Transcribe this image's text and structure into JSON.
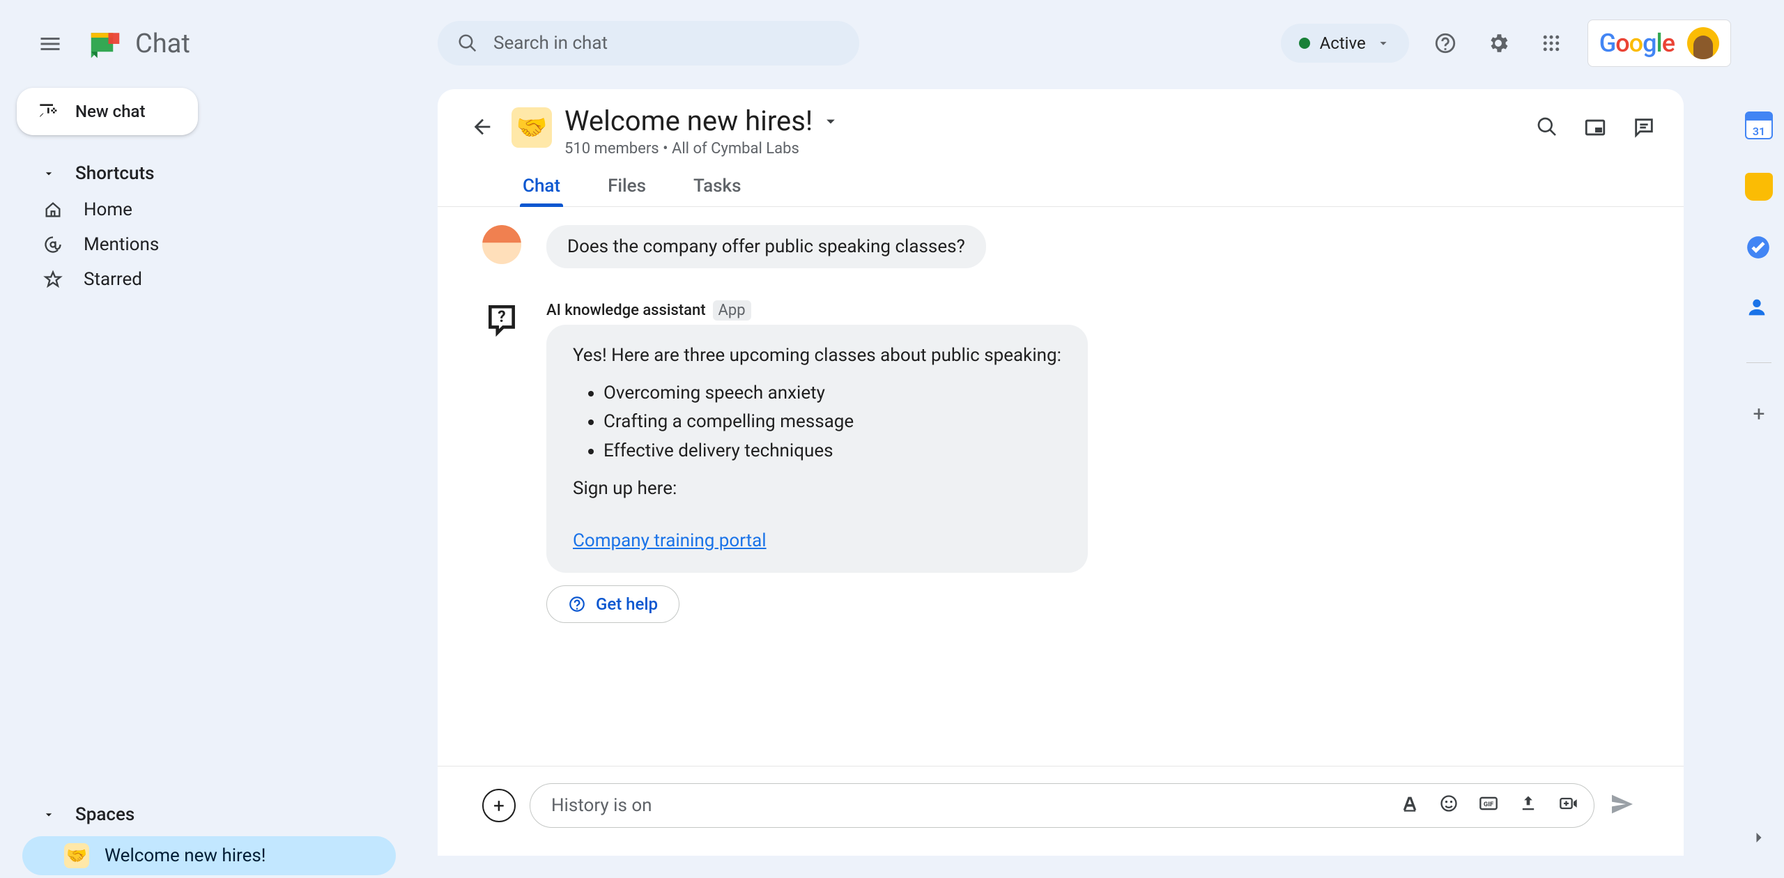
{
  "app": {
    "name": "Chat"
  },
  "header": {
    "search_placeholder": "Search in chat",
    "status_label": "Active"
  },
  "sidebar": {
    "new_chat_label": "New chat",
    "shortcuts_label": "Shortcuts",
    "items": [
      {
        "label": "Home",
        "icon": "home-icon"
      },
      {
        "label": "Mentions",
        "icon": "at-icon"
      },
      {
        "label": "Starred",
        "icon": "star-icon"
      }
    ],
    "spaces_label": "Spaces",
    "spaces": [
      {
        "label": "Welcome new hires!",
        "emoji": "🤝",
        "active": true
      }
    ]
  },
  "space": {
    "emoji": "🤝",
    "title": "Welcome new hires!",
    "subtitle": "510 members  •  All of Cymbal Labs",
    "tabs": [
      {
        "label": "Chat",
        "active": true
      },
      {
        "label": "Files",
        "active": false
      },
      {
        "label": "Tasks",
        "active": false
      }
    ]
  },
  "thread": {
    "user_msg": "Does the company offer public speaking classes?",
    "bot": {
      "name": "AI knowledge assistant",
      "tag": "App",
      "intro": "Yes! Here are three upcoming classes about public speaking:",
      "classes": [
        "Overcoming speech anxiety",
        "Crafting a compelling message",
        "Effective delivery techniques"
      ],
      "signup_label": "Sign up here:",
      "link_label": "Company training portal",
      "help_button": "Get help"
    }
  },
  "composer": {
    "placeholder": "History is on"
  },
  "icons": {
    "hamburger": "menu-icon",
    "search": "search-icon",
    "help": "help-icon",
    "settings": "gear-icon",
    "apps": "apps-grid-icon",
    "back": "arrow-left-icon",
    "dropdown": "chevron-down-icon",
    "search_in_space": "search-icon",
    "picture_in_picture": "pip-icon",
    "show_threads": "chat-lines-icon",
    "format": "format-icon",
    "emoji": "emoji-icon",
    "gif": "gif-icon",
    "upload": "upload-icon",
    "meet": "video-add-icon",
    "send": "send-icon"
  },
  "rail": {
    "calendar": "calendar-icon",
    "keep": "keep-icon",
    "tasks": "tasks-icon",
    "contacts": "contacts-icon"
  }
}
